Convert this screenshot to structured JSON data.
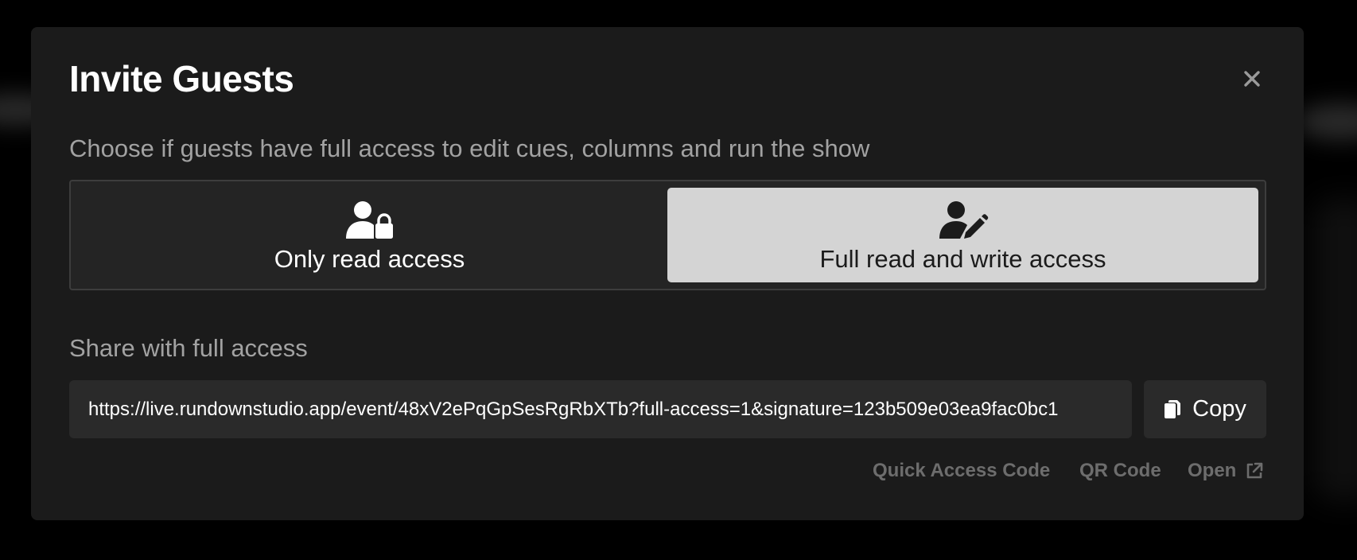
{
  "modal": {
    "title": "Invite Guests",
    "subtitle": "Choose if guests have full access to edit cues, columns and run the show"
  },
  "access_toggle": {
    "options": [
      {
        "label": "Only read access",
        "icon": "user-lock-icon",
        "selected": false
      },
      {
        "label": "Full read and write access",
        "icon": "user-pen-icon",
        "selected": true
      }
    ]
  },
  "share": {
    "label": "Share with full access",
    "url": "https://live.rundownstudio.app/event/48xV2ePqGpSesRgRbXTb?full-access=1&signature=123b509e03ea9fac0bc1",
    "copy_label": "Copy"
  },
  "links": {
    "quick_access": "Quick Access Code",
    "qr_code": "QR Code",
    "open": "Open"
  },
  "colors": {
    "modal_bg": "#1b1b1b",
    "selected_option_bg": "#d4d4d4",
    "field_bg": "#2a2a2a",
    "muted_text": "#a2a2a2",
    "link_text": "#6d6d6d"
  }
}
